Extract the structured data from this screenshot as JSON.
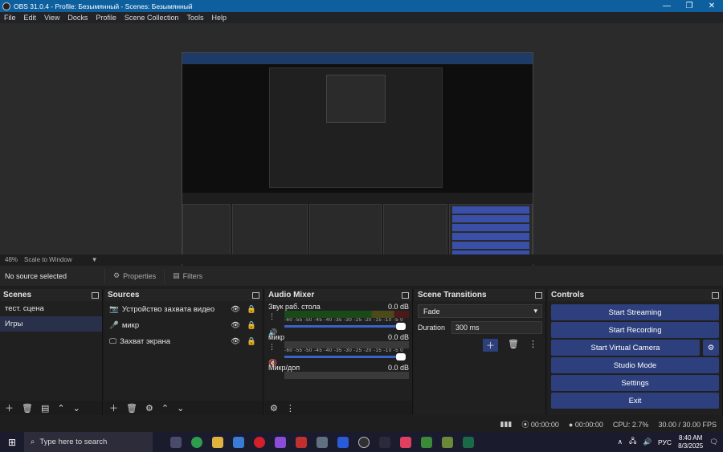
{
  "window": {
    "title": "OBS 31.0.4 - Profile: Безымянный - Scenes: Безымянный"
  },
  "menu": [
    "File",
    "Edit",
    "View",
    "Docks",
    "Profile",
    "Scene Collection",
    "Tools",
    "Help"
  ],
  "preview_status": {
    "zoom": "48%",
    "scale_mode": "Scale to Window"
  },
  "source_toolbar": {
    "no_source": "No source selected",
    "properties": "Properties",
    "filters": "Filters"
  },
  "scenes": {
    "title": "Scenes",
    "items": [
      "тест. сцена",
      "Игры"
    ],
    "selected": 1
  },
  "sources": {
    "title": "Sources",
    "items": [
      "Устройство захвата видео",
      "микр",
      "Захват экрана"
    ]
  },
  "audio_mixer": {
    "title": "Audio Mixer",
    "scale": "-60 -55 -50 -45 -40 -35 -30 -25 -20 -15 -10 -5 0",
    "channels": [
      {
        "name": "Звук раб. стола",
        "db": "0.0 dB",
        "muted": false
      },
      {
        "name": "микр",
        "db": "0.0 dB",
        "muted": true
      },
      {
        "name": "Микр/доп",
        "db": "0.0 dB",
        "muted": false
      }
    ]
  },
  "scene_transitions": {
    "title": "Scene Transitions",
    "transition": "Fade",
    "duration_label": "Duration",
    "duration": "300 ms"
  },
  "controls": {
    "title": "Controls",
    "buttons": [
      "Start Streaming",
      "Start Recording",
      "Start Virtual Camera",
      "Studio Mode",
      "Settings",
      "Exit"
    ]
  },
  "statusbar": {
    "stream_time": "00:00:00",
    "rec_time": "00:00:00",
    "cpu": "CPU: 2.7%",
    "fps": "30.00 / 30.00 FPS"
  },
  "taskbar": {
    "search_placeholder": "Type here to search",
    "lang": "РУС",
    "time": "8:40 AM",
    "date": "8/3/2025"
  },
  "colors": {
    "accent": "#2d3f7c",
    "titlebar": "#0d5f9e"
  }
}
